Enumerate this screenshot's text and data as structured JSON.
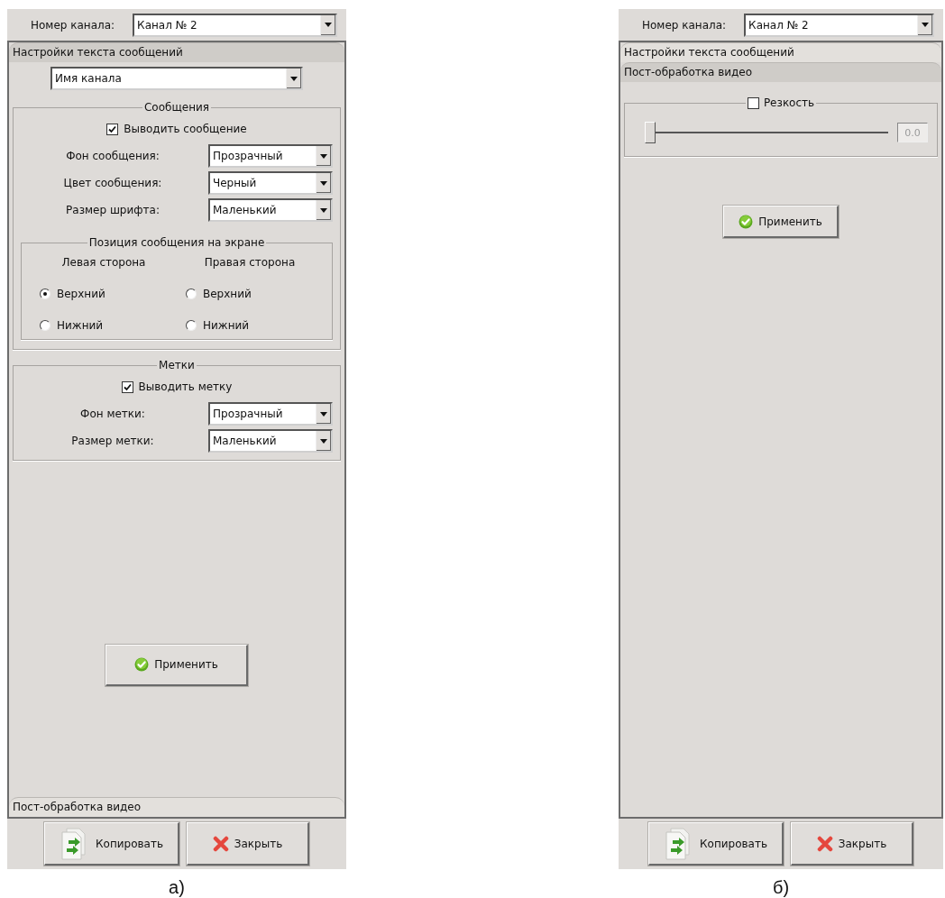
{
  "panels": [
    {
      "caption": "а)",
      "channel": {
        "label": "Номер канала:",
        "value": "Канал № 2"
      },
      "sections": [
        {
          "title": "Настройки текста сообщений",
          "expanded": true,
          "content": {
            "kind": "text",
            "source": "Имя канала",
            "groups": [
              {
                "title": "Сообщения",
                "checkbox": {
                  "label": "Выводить сообщение",
                  "checked": true
                },
                "fields": [
                  {
                    "label": "Фон сообщения:",
                    "value": "Прозрачный"
                  },
                  {
                    "label": "Цвет сообщения:",
                    "value": "Черный"
                  },
                  {
                    "label": "Размер шрифта:",
                    "value": "Маленький"
                  }
                ],
                "position": {
                  "title": "Позиция сообщения на экране",
                  "columns": [
                    {
                      "heading": "Левая сторона",
                      "options": [
                        {
                          "label": "Верхний",
                          "selected": true
                        },
                        {
                          "label": "Нижний",
                          "selected": false
                        }
                      ]
                    },
                    {
                      "heading": "Правая сторона",
                      "options": [
                        {
                          "label": "Верхний",
                          "selected": false
                        },
                        {
                          "label": "Нижний",
                          "selected": false
                        }
                      ]
                    }
                  ]
                }
              },
              {
                "title": "Метки",
                "checkbox": {
                  "label": "Выводить метку",
                  "checked": true
                },
                "fields": [
                  {
                    "label": "Фон метки:",
                    "value": "Прозрачный"
                  },
                  {
                    "label": "Размер метки:",
                    "value": "Маленький"
                  }
                ]
              }
            ],
            "apply": "Применить"
          }
        },
        {
          "title": "Пост-обработка видео",
          "expanded": false
        }
      ],
      "buttons": [
        {
          "label": "Копировать",
          "kind": "copy"
        },
        {
          "label": "Закрыть",
          "kind": "close"
        }
      ]
    },
    {
      "caption": "б)",
      "channel": {
        "label": "Номер канала:",
        "value": "Канал № 2"
      },
      "sections": [
        {
          "title": "Настройки текста сообщений",
          "expanded": false
        },
        {
          "title": "Пост-обработка видео",
          "expanded": true,
          "content": {
            "kind": "video",
            "checkbox": {
              "label": "Резкость",
              "checked": false
            },
            "slider": {
              "level": 0
            },
            "reading": "0.0",
            "apply": "Применить"
          }
        }
      ],
      "buttons": [
        {
          "label": "Копировать",
          "kind": "copy"
        },
        {
          "label": "Закрыть",
          "kind": "close"
        }
      ]
    }
  ]
}
